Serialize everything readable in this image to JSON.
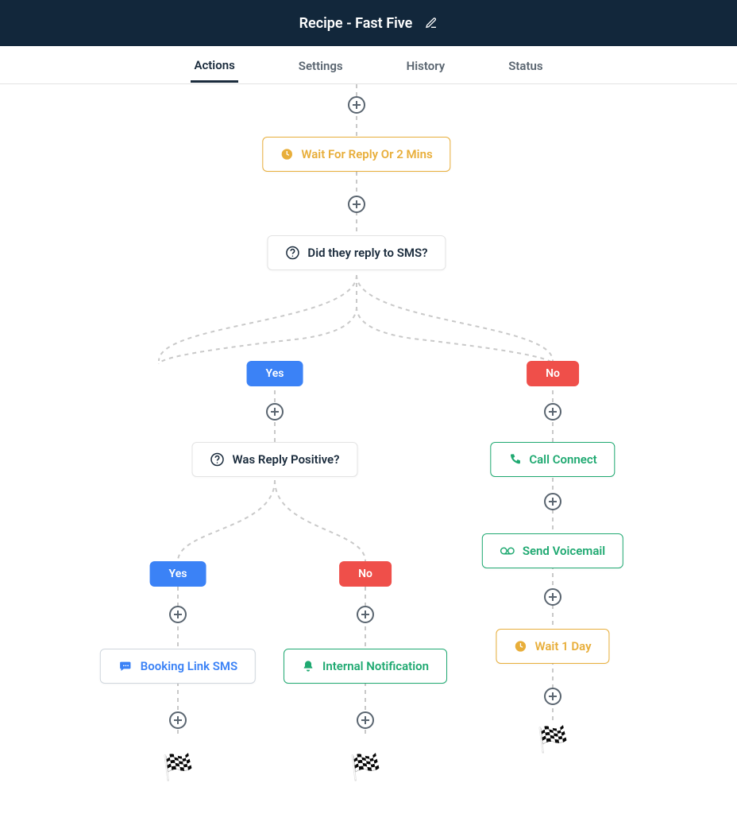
{
  "header": {
    "title": "Recipe - Fast Five"
  },
  "tabs": {
    "items": [
      {
        "label": "Actions",
        "active": true
      },
      {
        "label": "Settings",
        "active": false
      },
      {
        "label": "History",
        "active": false
      },
      {
        "label": "Status",
        "active": false
      }
    ]
  },
  "flow": {
    "wait1": "Wait For Reply Or 2 Mins",
    "q1": "Did they reply to SMS?",
    "yes": "Yes",
    "no": "No",
    "q2": "Was Reply Positive?",
    "call": "Call Connect",
    "voicemail": "Send Voicemail",
    "wait2": "Wait 1 Day",
    "booking": "Booking Link SMS",
    "internal": "Internal Notification"
  },
  "colors": {
    "yes_pill": "#3b82f6",
    "no_pill": "#ef4f4a",
    "wait": "#e8ae3a",
    "green": "#1fa971"
  }
}
